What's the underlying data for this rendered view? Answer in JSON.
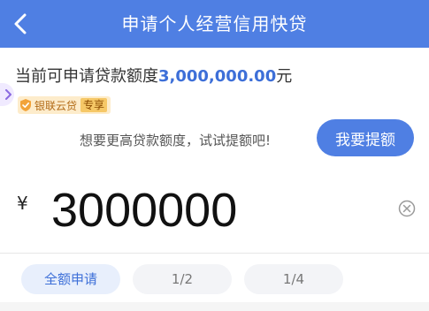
{
  "header": {
    "title": "申请个人经营信用快贷"
  },
  "quota": {
    "label": "当前可申请贷款额度",
    "amount": "3,000,000.00",
    "unit": "元"
  },
  "badge": {
    "brand": "银联云贷",
    "tag": "专享"
  },
  "hint": {
    "text": "想要更高贷款额度，试试提额吧!"
  },
  "raise_button": {
    "label": "我要提额"
  },
  "amount": {
    "currency": "¥",
    "value": "3000000"
  },
  "options": [
    {
      "label": "全额申请",
      "selected": true
    },
    {
      "label": "1/2",
      "selected": false
    },
    {
      "label": "1/4",
      "selected": false
    }
  ],
  "colors": {
    "primary": "#4f7fe3",
    "accent_text": "#3d6fd8",
    "badge_bg": "#fdeccb"
  },
  "icons": {
    "back": "chevron-left-icon",
    "clear": "clear-icon",
    "shield": "shield-icon",
    "side_tab": "chevron-right-icon"
  }
}
